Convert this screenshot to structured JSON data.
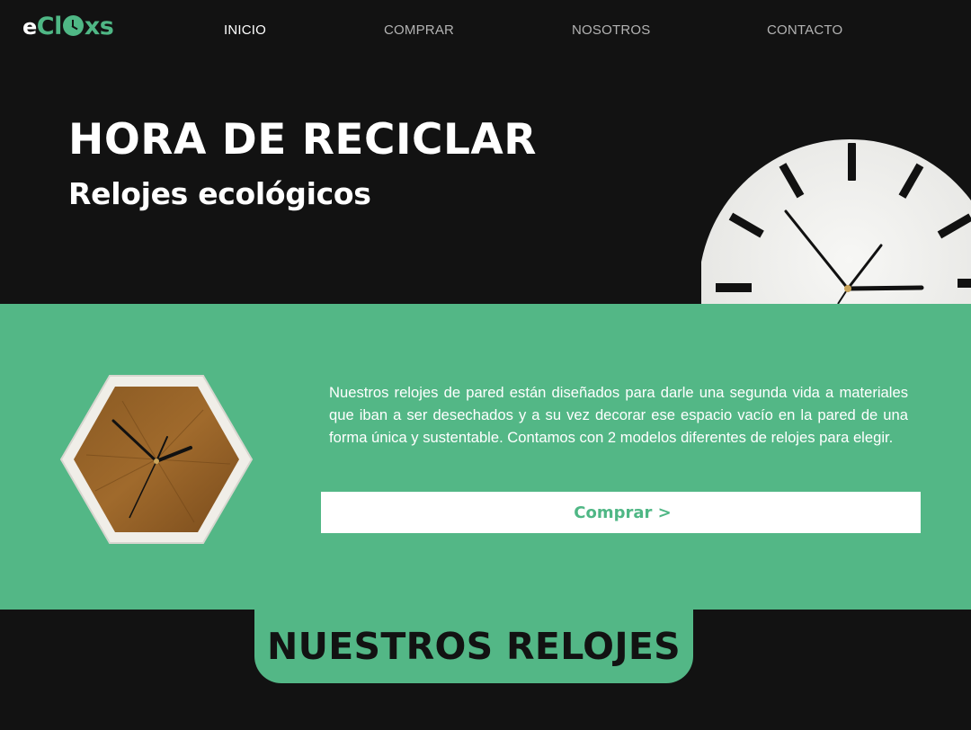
{
  "brand": {
    "prefix": "e",
    "name_c": "Cl",
    "name_rest": "xs",
    "accent": "#53b786"
  },
  "nav": {
    "items": [
      {
        "label": "INICIO",
        "active": true
      },
      {
        "label": "COMPRAR",
        "active": false
      },
      {
        "label": "NOSOTROS",
        "active": false
      },
      {
        "label": "CONTACTO",
        "active": false
      }
    ]
  },
  "hero": {
    "title": "HORA DE RECICLAR",
    "subtitle": "Relojes ecológicos"
  },
  "band": {
    "description": "Nuestros relojes de pared están diseñados para darle una segunda vida a materiales que iban a ser desechados y a su vez decorar ese espacio vacío en la pared de una forma única y sustentable. Contamos con 2 modelos diferentes de relojes para elegir.",
    "button_label": "Comprar >"
  },
  "section": {
    "title": "NUESTROS RELOJES"
  },
  "colors": {
    "background": "#121212",
    "green": "#53b786",
    "white": "#ffffff"
  }
}
